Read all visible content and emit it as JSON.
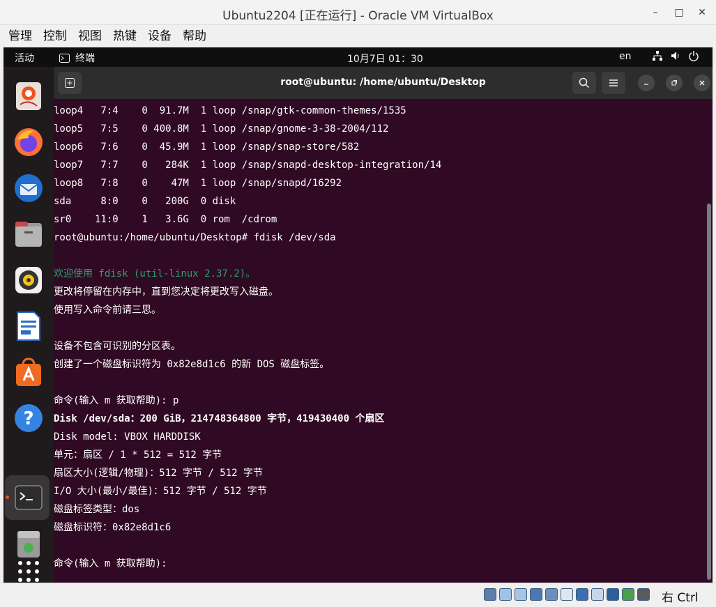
{
  "host_window": {
    "title": "Ubuntu2204 [正在运行] - Oracle VM VirtualBox",
    "minimize": "–",
    "maximize": "□",
    "close": "✕"
  },
  "menubar": [
    "管理",
    "控制",
    "视图",
    "热键",
    "设备",
    "帮助"
  ],
  "topbar": {
    "activities": "活动",
    "app_name": "终端",
    "clock": "10月7日  01：30",
    "lang": "en"
  },
  "terminal": {
    "title": "root@ubuntu: /home/ubuntu/Desktop",
    "lines": [
      {
        "text": "loop4   7:4    0  91.7M  1 loop /snap/gtk-common-themes/1535",
        "style": ""
      },
      {
        "text": "loop5   7:5    0 400.8M  1 loop /snap/gnome-3-38-2004/112",
        "style": ""
      },
      {
        "text": "loop6   7:6    0  45.9M  1 loop /snap/snap-store/582",
        "style": ""
      },
      {
        "text": "loop7   7:7    0   284K  1 loop /snap/snapd-desktop-integration/14",
        "style": ""
      },
      {
        "text": "loop8   7:8    0    47M  1 loop /snap/snapd/16292",
        "style": ""
      },
      {
        "text": "sda     8:0    0   200G  0 disk",
        "style": ""
      },
      {
        "text": "sr0    11:0    1   3.6G  0 rom  /cdrom",
        "style": ""
      },
      {
        "text": "root@ubuntu:/home/ubuntu/Desktop# fdisk /dev/sda",
        "style": ""
      },
      {
        "text": "",
        "style": ""
      },
      {
        "text": "欢迎使用 fdisk (util-linux 2.37.2)。",
        "style": "green"
      },
      {
        "text": "更改将停留在内存中，直到您决定将更改写入磁盘。",
        "style": ""
      },
      {
        "text": "使用写入命令前请三思。",
        "style": ""
      },
      {
        "text": "",
        "style": ""
      },
      {
        "text": "设备不包含可识别的分区表。",
        "style": ""
      },
      {
        "text": "创建了一个磁盘标识符为 0x82e8d1c6 的新 DOS 磁盘标签。",
        "style": ""
      },
      {
        "text": "",
        "style": ""
      },
      {
        "text": "命令(输入 m 获取帮助): p",
        "style": ""
      },
      {
        "text": "Disk /dev/sda：200 GiB，214748364800 字节，419430400 个扇区",
        "style": "bold"
      },
      {
        "text": "Disk model: VBOX HARDDISK",
        "style": ""
      },
      {
        "text": "单元：扇区 / 1 * 512 = 512 字节",
        "style": ""
      },
      {
        "text": "扇区大小(逻辑/物理)：512 字节 / 512 字节",
        "style": ""
      },
      {
        "text": "I/O 大小(最小/最佳)：512 字节 / 512 字节",
        "style": ""
      },
      {
        "text": "磁盘标签类型：dos",
        "style": ""
      },
      {
        "text": "磁盘标识符：0x82e8d1c6",
        "style": ""
      },
      {
        "text": "",
        "style": ""
      },
      {
        "text": "命令(输入 m 获取帮助): ",
        "style": ""
      }
    ]
  },
  "dock": [
    {
      "name": "ubuntu-software-sig-icon",
      "color": "#e95420"
    },
    {
      "name": "firefox-icon",
      "color": "#ff7139"
    },
    {
      "name": "thunderbird-icon",
      "color": "#2a7fd4"
    },
    {
      "name": "files-icon",
      "color": "#9a9a9a"
    },
    {
      "name": "rhythmbox-icon",
      "color": "#f5c211"
    },
    {
      "name": "libreoffice-writer-icon",
      "color": "#2a6cc4"
    },
    {
      "name": "app-center-icon",
      "color": "#f06a22"
    },
    {
      "name": "help-icon",
      "color": "#3584e4"
    },
    {
      "name": "terminal-icon",
      "color": "#2d2d2d"
    },
    {
      "name": "trash-icon",
      "color": "#8a8a8a"
    },
    {
      "name": "show-apps-icon",
      "color": "#ffffff"
    }
  ],
  "statusbar": {
    "host_key": "右 Ctrl"
  }
}
